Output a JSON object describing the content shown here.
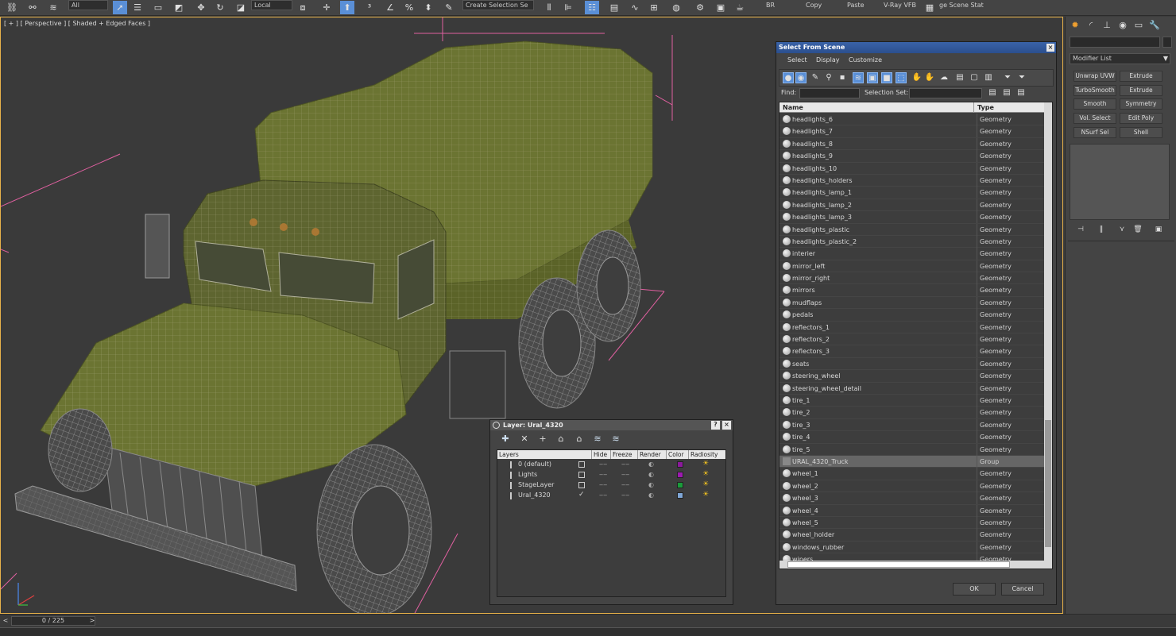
{
  "toolbar": {
    "selection_filter": "All",
    "coordinate_system": "Local",
    "selection_set_placeholder": "Create Selection Se",
    "labels": [
      "BR",
      "Copy",
      "Paste",
      "V-Ray VFB",
      "ge Scene Stat"
    ]
  },
  "viewport": {
    "label": "[ + ] [ Perspective ] [ Shaded + Edged Faces ]"
  },
  "timeline": {
    "frame": "0 / 225",
    "prev": "<",
    "next": ">"
  },
  "command_panel": {
    "modifier_list": "Modifier List",
    "modifiers": [
      "Unwrap UVW",
      "Extrude",
      "TurboSmooth",
      "Extrude",
      "Smooth",
      "Symmetry",
      "Vol. Select",
      "Edit Poly",
      "NSurf Sel",
      "Shell"
    ]
  },
  "select_from_scene": {
    "title": "Select From Scene",
    "close": "×",
    "menu": [
      "Select",
      "Display",
      "Customize"
    ],
    "find_label": "Find:",
    "selection_set_label": "Selection Set:",
    "columns": {
      "name": "Name",
      "type": "Type"
    },
    "objects": [
      {
        "name": "headlights_6",
        "type": "Geometry"
      },
      {
        "name": "headlights_7",
        "type": "Geometry"
      },
      {
        "name": "headlights_8",
        "type": "Geometry"
      },
      {
        "name": "headlights_9",
        "type": "Geometry"
      },
      {
        "name": "headlights_10",
        "type": "Geometry"
      },
      {
        "name": "headlights_holders",
        "type": "Geometry"
      },
      {
        "name": "headlights_lamp_1",
        "type": "Geometry"
      },
      {
        "name": "headlights_lamp_2",
        "type": "Geometry"
      },
      {
        "name": "headlights_lamp_3",
        "type": "Geometry"
      },
      {
        "name": "headlights_plastic",
        "type": "Geometry"
      },
      {
        "name": "headlights_plastic_2",
        "type": "Geometry"
      },
      {
        "name": "interier",
        "type": "Geometry"
      },
      {
        "name": "mirror_left",
        "type": "Geometry"
      },
      {
        "name": "mirror_right",
        "type": "Geometry"
      },
      {
        "name": "mirrors",
        "type": "Geometry"
      },
      {
        "name": "mudflaps",
        "type": "Geometry"
      },
      {
        "name": "pedals",
        "type": "Geometry"
      },
      {
        "name": "reflectors_1",
        "type": "Geometry"
      },
      {
        "name": "reflectors_2",
        "type": "Geometry"
      },
      {
        "name": "reflectors_3",
        "type": "Geometry"
      },
      {
        "name": "seats",
        "type": "Geometry"
      },
      {
        "name": "steering_wheel",
        "type": "Geometry"
      },
      {
        "name": "steering_wheel_detail",
        "type": "Geometry"
      },
      {
        "name": "tire_1",
        "type": "Geometry"
      },
      {
        "name": "tire_2",
        "type": "Geometry"
      },
      {
        "name": "tire_3",
        "type": "Geometry"
      },
      {
        "name": "tire_4",
        "type": "Geometry"
      },
      {
        "name": "tire_5",
        "type": "Geometry"
      },
      {
        "name": "URAL_4320_Truck",
        "type": "Group",
        "selected": true
      },
      {
        "name": "wheel_1",
        "type": "Geometry"
      },
      {
        "name": "wheel_2",
        "type": "Geometry"
      },
      {
        "name": "wheel_3",
        "type": "Geometry"
      },
      {
        "name": "wheel_4",
        "type": "Geometry"
      },
      {
        "name": "wheel_5",
        "type": "Geometry"
      },
      {
        "name": "wheel_holder",
        "type": "Geometry"
      },
      {
        "name": "windows_rubber",
        "type": "Geometry"
      },
      {
        "name": "wipers",
        "type": "Geometry"
      }
    ],
    "ok": "OK",
    "cancel": "Cancel"
  },
  "layer_dialog": {
    "title": "Layer: Ural_4320",
    "help": "?",
    "close": "×",
    "columns": [
      "Layers",
      "Hide",
      "Freeze",
      "Render",
      "Color",
      "Radiosity"
    ],
    "layers": [
      {
        "name": "0 (default)",
        "color": "#8b1a9c",
        "current": false
      },
      {
        "name": "Lights",
        "color": "#9c1ab0",
        "current": false
      },
      {
        "name": "StageLayer",
        "color": "#1a9c3a",
        "current": false
      },
      {
        "name": "Ural_4320",
        "color": "#7fa6d6",
        "current": true
      }
    ]
  },
  "colors": {
    "accent": "#5a8fd6",
    "viewport_border": "#e8b24a",
    "mesh": "#6b7432",
    "bbox": "#e060a0"
  }
}
